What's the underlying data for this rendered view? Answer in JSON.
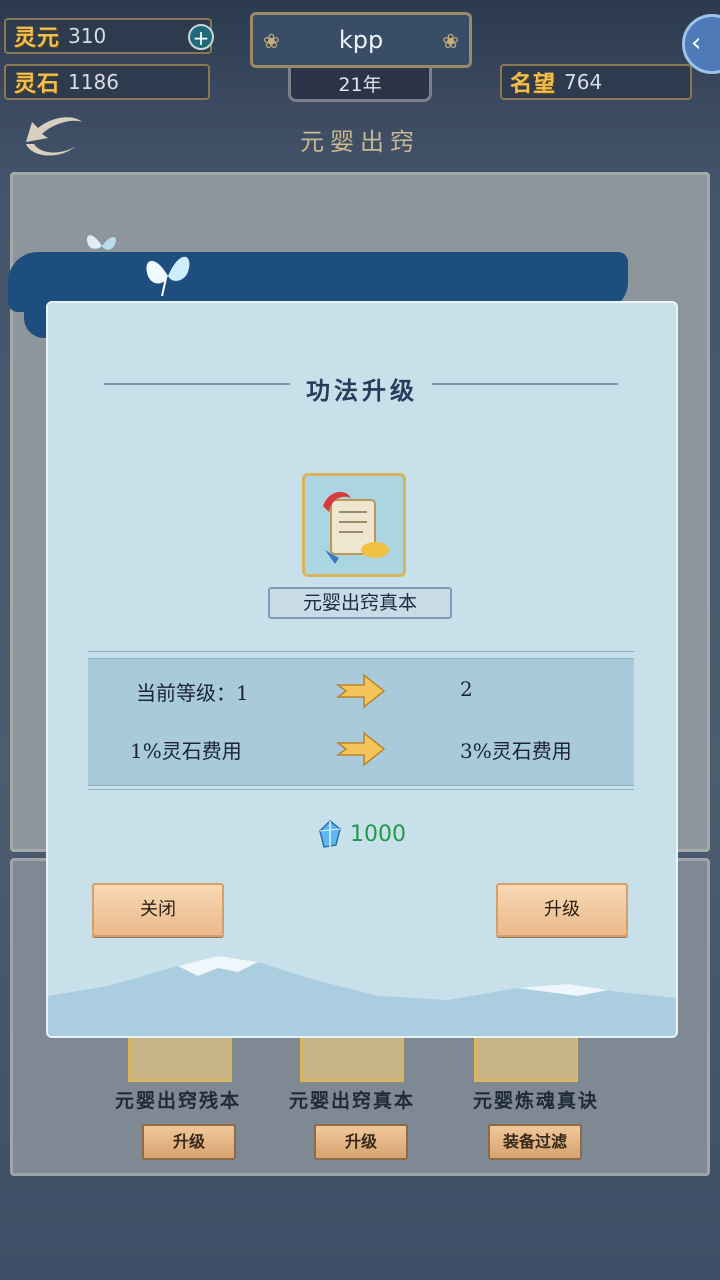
{
  "hud": {
    "lingyuan_label": "灵元",
    "lingyuan_value": "310",
    "lingshi_label": "灵石",
    "lingshi_value": "1186",
    "player_name": "kpp",
    "year": "21年",
    "mingwang_label": "名望",
    "mingwang_value": "764"
  },
  "page": {
    "title": "元婴出窍"
  },
  "items": [
    {
      "name": "元婴出窍残本",
      "button": "升级"
    },
    {
      "name": "元婴出窍真本",
      "button": "升级"
    },
    {
      "name": "元婴炼魂真诀",
      "button": "装备过滤"
    }
  ],
  "modal": {
    "title": "功法升级",
    "skill_name": "元婴出窍真本",
    "current_level_label": "当前等级：1",
    "next_level": "2",
    "current_cost": "1%灵石费用",
    "next_cost": "3%灵石费用",
    "cost_amount": "1000",
    "close_label": "关闭",
    "upgrade_label": "升级"
  },
  "colors": {
    "hud_label": "#f0c050",
    "modal_bg": "#c8e0ea",
    "cost_green": "#1f9a4d",
    "button_peach": "#eab98d"
  }
}
